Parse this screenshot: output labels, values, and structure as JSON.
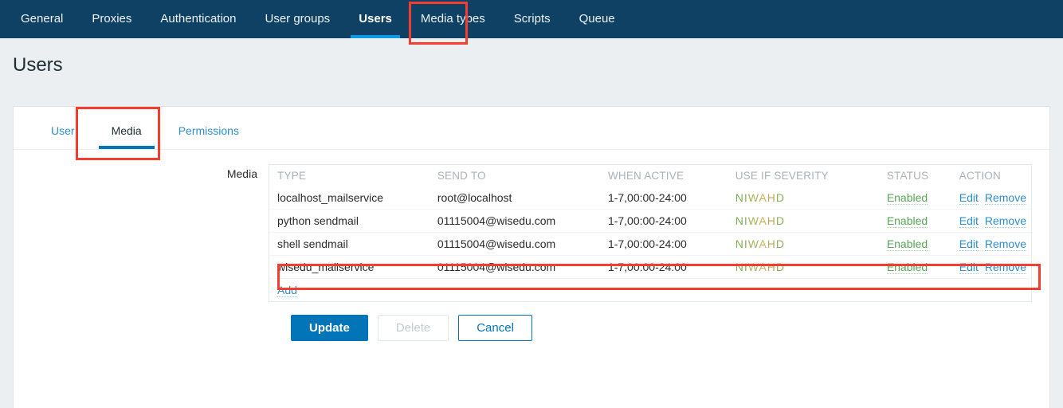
{
  "topnav": {
    "items": [
      {
        "label": "General",
        "active": false
      },
      {
        "label": "Proxies",
        "active": false
      },
      {
        "label": "Authentication",
        "active": false
      },
      {
        "label": "User groups",
        "active": false
      },
      {
        "label": "Users",
        "active": true
      },
      {
        "label": "Media types",
        "active": false
      },
      {
        "label": "Scripts",
        "active": false
      },
      {
        "label": "Queue",
        "active": false
      }
    ]
  },
  "page": {
    "title": "Users"
  },
  "tabs": [
    {
      "label": "User",
      "active": false
    },
    {
      "label": "Media",
      "active": true
    },
    {
      "label": "Permissions",
      "active": false
    }
  ],
  "form": {
    "media_label": "Media"
  },
  "media_table": {
    "headers": {
      "type": "TYPE",
      "send_to": "SEND TO",
      "when_active": "WHEN ACTIVE",
      "use_if_severity": "USE IF SEVERITY",
      "status": "STATUS",
      "action": "ACTION"
    },
    "severity_letters": [
      "N",
      "I",
      "W",
      "A",
      "H",
      "D"
    ],
    "severity_colors": [
      "#7eaf5a",
      "#7eaf5a",
      "#a9b55e",
      "#c9b15a",
      "#b9a85c",
      "#8fae5c"
    ],
    "rows": [
      {
        "type": "localhost_mailservice",
        "send_to": "root@localhost",
        "when_active": "1-7,00:00-24:00",
        "severity": "NIWAHD",
        "status": "Enabled",
        "edit": "Edit",
        "remove": "Remove",
        "highlighted": false
      },
      {
        "type": "python sendmail",
        "send_to": "01115004@wisedu.com",
        "when_active": "1-7,00:00-24:00",
        "severity": "NIWAHD",
        "status": "Enabled",
        "edit": "Edit",
        "remove": "Remove",
        "highlighted": false
      },
      {
        "type": "shell sendmail",
        "send_to": "01115004@wisedu.com",
        "when_active": "1-7,00:00-24:00",
        "severity": "NIWAHD",
        "status": "Enabled",
        "edit": "Edit",
        "remove": "Remove",
        "highlighted": true
      },
      {
        "type": "wisedu_mailservice",
        "send_to": "01115004@wisedu.com",
        "when_active": "1-7,00:00-24:00",
        "severity": "NIWAHD",
        "status": "Enabled",
        "edit": "Edit",
        "remove": "Remove",
        "highlighted": false
      }
    ],
    "add_label": "Add"
  },
  "buttons": {
    "update": "Update",
    "delete": "Delete",
    "cancel": "Cancel"
  },
  "colors": {
    "nav_bg": "#0e4164",
    "accent_blue": "#0275b8",
    "active_underline": "#0c9ae4",
    "link": "#2e8ece",
    "enabled_green": "#59a659",
    "highlight_red": "#f43d2e",
    "page_bg": "#ebeff2"
  }
}
